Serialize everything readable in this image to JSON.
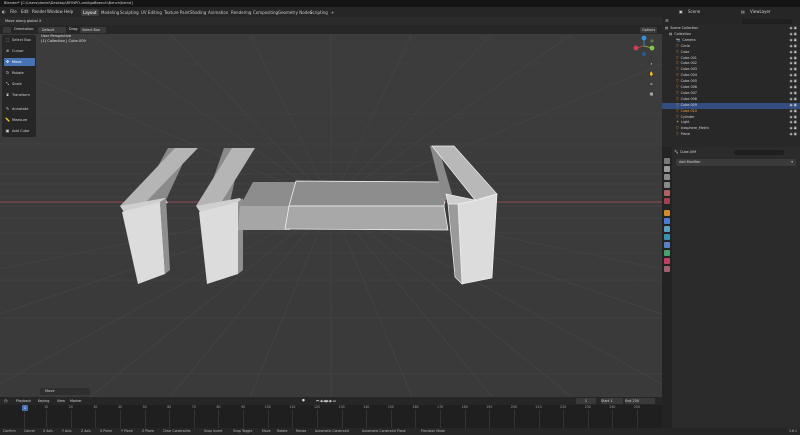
{
  "titlebar": {
    "title": "Blender* [C:\\Users\\daniel\\Desktop\\RFINPO-omitgoBbench\\Bench\\blend]"
  },
  "menu": {
    "items": [
      "File",
      "Edit",
      "Render",
      "Window",
      "Help"
    ]
  },
  "workspaces": {
    "tabs": [
      "Layout",
      "Modeling",
      "Sculpting",
      "UV Editing",
      "Texture Paint",
      "Shading",
      "Animation",
      "Rendering",
      "Compositing",
      "Geometry Nodes",
      "Scripting"
    ],
    "active": "Layout"
  },
  "scene": {
    "label": "Scene",
    "view_layer": "ViewLayer"
  },
  "header": {
    "hint": "Move along global X"
  },
  "toolrow": {
    "orientation_label": "Orientation:",
    "orientation_value": "Default",
    "drag_label": "Drag:",
    "drag_value": "Select Box",
    "options_label": "Options"
  },
  "viewport": {
    "view_name": "User Perspective",
    "collection_path": "(1) Collection | Cube.009",
    "gizmo_axes": [
      "X",
      "Y",
      "Z"
    ]
  },
  "tools": [
    {
      "label": "Select Box",
      "icon": "select-box-icon"
    },
    {
      "label": "Cursor",
      "icon": "cursor-icon"
    },
    {
      "label": "Move",
      "icon": "move-icon",
      "active": true
    },
    {
      "label": "Rotate",
      "icon": "rotate-icon"
    },
    {
      "label": "Scale",
      "icon": "scale-icon"
    },
    {
      "label": "Transform",
      "icon": "transform-icon"
    },
    {
      "label": "Annotate",
      "icon": "annotate-icon"
    },
    {
      "label": "Measure",
      "icon": "measure-icon"
    },
    {
      "label": "Add Cube",
      "icon": "add-cube-icon"
    }
  ],
  "operator_panel": {
    "label": "Move"
  },
  "timeline": {
    "menu": [
      "Playback",
      "Keying",
      "View",
      "Marker"
    ],
    "current_frame": "1",
    "start_label": "Start",
    "start_value": "1",
    "end_label": "End",
    "end_value": "250",
    "ruler_ticks": [
      "1",
      "10",
      "20",
      "30",
      "40",
      "50",
      "60",
      "70",
      "80",
      "90",
      "100",
      "110",
      "120",
      "130",
      "140",
      "150",
      "160",
      "170",
      "180",
      "190",
      "200",
      "210",
      "220",
      "230",
      "240",
      "250"
    ]
  },
  "statusbar": {
    "items": [
      "Confirm",
      "Cancel",
      "X Axis",
      "Y Axis",
      "Z Axis",
      "X Plane",
      "Y Plane",
      "Z Plane",
      "Clear Constraints",
      "Snap Invert",
      "Snap Toggle",
      "Move",
      "Rotate",
      "Resize",
      "Automatic Constraint",
      "Automatic Constraint Plane",
      "Precision Mode"
    ],
    "version": "3.6.1"
  },
  "outliner": {
    "root": "Scene Collection",
    "collection": "Collection",
    "items": [
      {
        "name": "Camera",
        "type": "camera"
      },
      {
        "name": "Circle",
        "type": "mesh"
      },
      {
        "name": "Cube",
        "type": "mesh"
      },
      {
        "name": "Cube.001",
        "type": "mesh"
      },
      {
        "name": "Cube.002",
        "type": "mesh"
      },
      {
        "name": "Cube.003",
        "type": "mesh"
      },
      {
        "name": "Cube.004",
        "type": "mesh"
      },
      {
        "name": "Cube.005",
        "type": "mesh"
      },
      {
        "name": "Cube.006",
        "type": "mesh"
      },
      {
        "name": "Cube.007",
        "type": "mesh"
      },
      {
        "name": "Cube.008",
        "type": "mesh"
      },
      {
        "name": "Cube.009",
        "type": "mesh"
      },
      {
        "name": "Cube.010",
        "type": "mesh",
        "active": true
      },
      {
        "name": "Cylinder",
        "type": "mesh"
      },
      {
        "name": "Light",
        "type": "light"
      },
      {
        "name": "Icosphere_Metric",
        "type": "mesh"
      },
      {
        "name": "Plane",
        "type": "mesh"
      }
    ]
  },
  "properties": {
    "object_name": "Cube.009",
    "add_modifier": "Add Modifier"
  },
  "colors": {
    "accent": "#4772b3",
    "active_object": "#ff9d3d",
    "x_axis": "#d04055",
    "y_axis": "#8bc34a",
    "z_axis": "#3d8fdc"
  }
}
